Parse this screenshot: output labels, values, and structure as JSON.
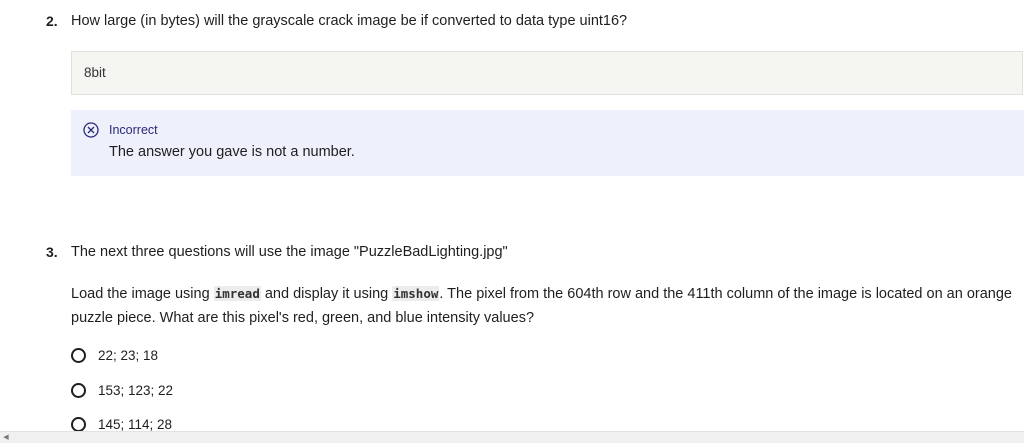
{
  "question2": {
    "number": "2.",
    "text": "How large (in bytes) will the grayscale crack image be if converted to data type uint16?",
    "answer_value": "8bit",
    "feedback": {
      "icon": "x-circle-icon",
      "status": "Incorrect",
      "message": "The answer you gave is not a number."
    }
  },
  "question3": {
    "number": "3.",
    "text": "The next three questions will use the image \"PuzzleBadLighting.jpg\"",
    "para": {
      "part1": "Load the image using ",
      "code1": "imread",
      "part2": " and display it using ",
      "code2": "imshow",
      "part3": ". The pixel from the 604th row and the 411th column of the image is located on an orange puzzle piece. What are this pixel's red, green, and blue intensity values?"
    },
    "options": [
      {
        "label": "22; 23; 18"
      },
      {
        "label": "153; 123; 22"
      },
      {
        "label": "145; 114; 28"
      }
    ]
  },
  "colors": {
    "feedback_bg": "#eef0fb",
    "feedback_accent": "#2a2a7a",
    "answer_bg": "#f5f5f2"
  }
}
